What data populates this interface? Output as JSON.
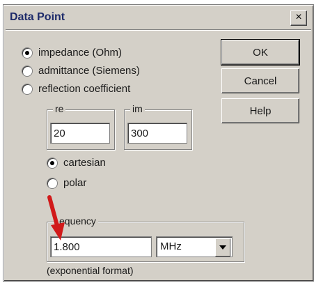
{
  "dialog": {
    "title": "Data Point",
    "close_label": "×"
  },
  "type_options": [
    {
      "label": "impedance (Ohm)",
      "selected": true
    },
    {
      "label": "admittance (Siemens)",
      "selected": false
    },
    {
      "label": "reflection coefficient",
      "selected": false
    }
  ],
  "buttons": {
    "ok": "OK",
    "cancel": "Cancel",
    "help": "Help"
  },
  "re_group": {
    "label": "re",
    "value": "20"
  },
  "im_group": {
    "label": "im",
    "value": "300"
  },
  "coord_options": [
    {
      "label": "cartesian",
      "selected": true
    },
    {
      "label": "polar",
      "selected": false
    }
  ],
  "frequency": {
    "label": "equency",
    "value": "1.800",
    "unit": "MHz",
    "note": "(exponential format)"
  },
  "colors": {
    "dialog_bg": "#d4d0c8",
    "annotation_arrow": "#d11a1a"
  }
}
